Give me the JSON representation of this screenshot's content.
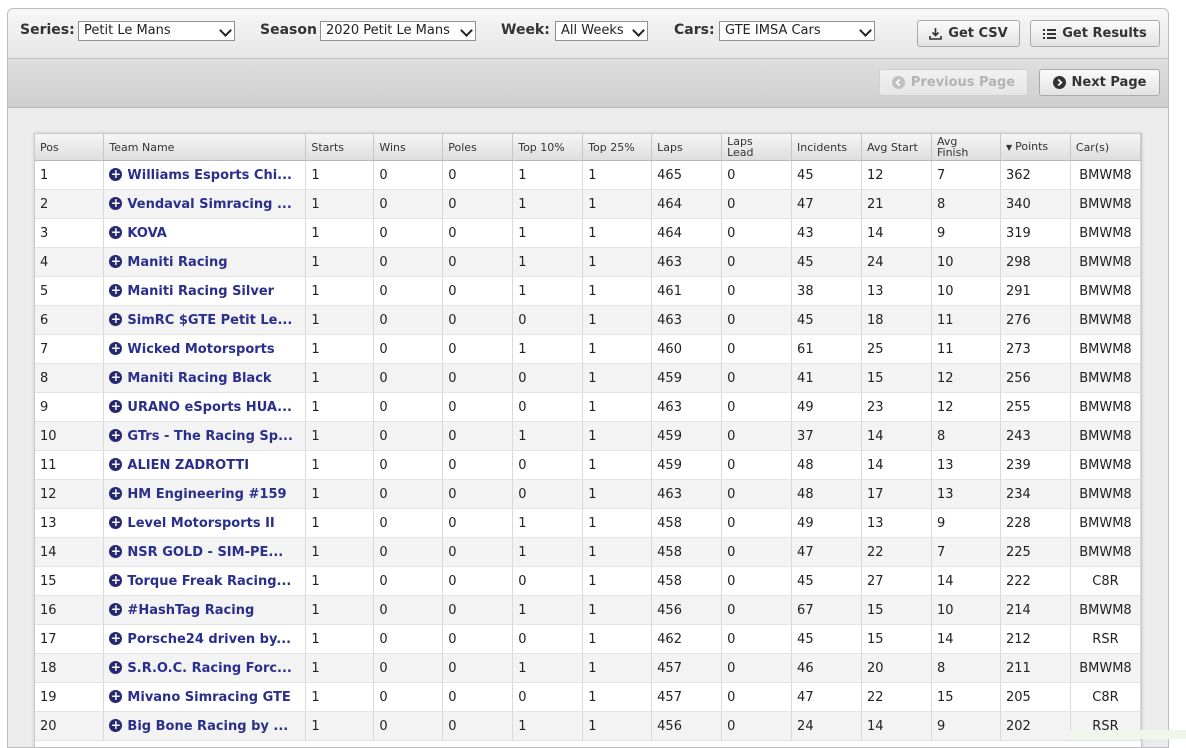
{
  "filters": {
    "series_label": "Series:",
    "series_value": "Petit Le Mans",
    "season_label": "Season",
    "season_value": "2020 Petit Le Mans",
    "week_label": "Week:",
    "week_value": "All Weeks",
    "cars_label": "Cars:",
    "cars_value": "GTE IMSA Cars"
  },
  "buttons": {
    "csv": "Get CSV",
    "results": "Get Results",
    "prev": "Previous Page",
    "next": "Next Page"
  },
  "table": {
    "columns": [
      "Pos",
      "Team Name",
      "Starts",
      "Wins",
      "Poles",
      "Top 10%",
      "Top 25%",
      "Laps",
      "Laps Lead",
      "Incidents",
      "Avg Start",
      "Avg Finish",
      "Points",
      "Car(s)"
    ],
    "sorted_column": "Points",
    "rows": [
      {
        "pos": "1",
        "team": "Williams Esports Chi...",
        "starts": "1",
        "wins": "0",
        "poles": "0",
        "top10": "1",
        "top25": "1",
        "laps": "465",
        "lead": "0",
        "inc": "45",
        "avgstart": "12",
        "avgfinish": "7",
        "points": "362",
        "car": "BMWM8"
      },
      {
        "pos": "2",
        "team": "Vendaval Simracing ...",
        "starts": "1",
        "wins": "0",
        "poles": "0",
        "top10": "1",
        "top25": "1",
        "laps": "464",
        "lead": "0",
        "inc": "47",
        "avgstart": "21",
        "avgfinish": "8",
        "points": "340",
        "car": "BMWM8"
      },
      {
        "pos": "3",
        "team": "KOVA",
        "starts": "1",
        "wins": "0",
        "poles": "0",
        "top10": "1",
        "top25": "1",
        "laps": "464",
        "lead": "0",
        "inc": "43",
        "avgstart": "14",
        "avgfinish": "9",
        "points": "319",
        "car": "BMWM8"
      },
      {
        "pos": "4",
        "team": "Maniti Racing",
        "starts": "1",
        "wins": "0",
        "poles": "0",
        "top10": "1",
        "top25": "1",
        "laps": "463",
        "lead": "0",
        "inc": "45",
        "avgstart": "24",
        "avgfinish": "10",
        "points": "298",
        "car": "BMWM8"
      },
      {
        "pos": "5",
        "team": "Maniti Racing Silver",
        "starts": "1",
        "wins": "0",
        "poles": "0",
        "top10": "1",
        "top25": "1",
        "laps": "461",
        "lead": "0",
        "inc": "38",
        "avgstart": "13",
        "avgfinish": "10",
        "points": "291",
        "car": "BMWM8"
      },
      {
        "pos": "6",
        "team": "SimRC $GTE Petit Le...",
        "starts": "1",
        "wins": "0",
        "poles": "0",
        "top10": "0",
        "top25": "1",
        "laps": "463",
        "lead": "0",
        "inc": "45",
        "avgstart": "18",
        "avgfinish": "11",
        "points": "276",
        "car": "BMWM8"
      },
      {
        "pos": "7",
        "team": "Wicked Motorsports",
        "starts": "1",
        "wins": "0",
        "poles": "0",
        "top10": "1",
        "top25": "1",
        "laps": "460",
        "lead": "0",
        "inc": "61",
        "avgstart": "25",
        "avgfinish": "11",
        "points": "273",
        "car": "BMWM8"
      },
      {
        "pos": "8",
        "team": "Maniti Racing Black",
        "starts": "1",
        "wins": "0",
        "poles": "0",
        "top10": "0",
        "top25": "1",
        "laps": "459",
        "lead": "0",
        "inc": "41",
        "avgstart": "15",
        "avgfinish": "12",
        "points": "256",
        "car": "BMWM8"
      },
      {
        "pos": "9",
        "team": "URANO eSports HUA...",
        "starts": "1",
        "wins": "0",
        "poles": "0",
        "top10": "0",
        "top25": "1",
        "laps": "463",
        "lead": "0",
        "inc": "49",
        "avgstart": "23",
        "avgfinish": "12",
        "points": "255",
        "car": "BMWM8"
      },
      {
        "pos": "10",
        "team": "GTrs - The Racing Sp...",
        "starts": "1",
        "wins": "0",
        "poles": "0",
        "top10": "1",
        "top25": "1",
        "laps": "459",
        "lead": "0",
        "inc": "37",
        "avgstart": "14",
        "avgfinish": "8",
        "points": "243",
        "car": "BMWM8"
      },
      {
        "pos": "11",
        "team": "ALIEN ZADROTTI",
        "starts": "1",
        "wins": "0",
        "poles": "0",
        "top10": "0",
        "top25": "1",
        "laps": "459",
        "lead": "0",
        "inc": "48",
        "avgstart": "14",
        "avgfinish": "13",
        "points": "239",
        "car": "BMWM8"
      },
      {
        "pos": "12",
        "team": "HM Engineering #159",
        "starts": "1",
        "wins": "0",
        "poles": "0",
        "top10": "0",
        "top25": "1",
        "laps": "463",
        "lead": "0",
        "inc": "48",
        "avgstart": "17",
        "avgfinish": "13",
        "points": "234",
        "car": "BMWM8"
      },
      {
        "pos": "13",
        "team": "Level Motorsports II",
        "starts": "1",
        "wins": "0",
        "poles": "0",
        "top10": "1",
        "top25": "1",
        "laps": "458",
        "lead": "0",
        "inc": "49",
        "avgstart": "13",
        "avgfinish": "9",
        "points": "228",
        "car": "BMWM8"
      },
      {
        "pos": "14",
        "team": "NSR GOLD - SIM-PE...",
        "starts": "1",
        "wins": "0",
        "poles": "0",
        "top10": "1",
        "top25": "1",
        "laps": "458",
        "lead": "0",
        "inc": "47",
        "avgstart": "22",
        "avgfinish": "7",
        "points": "225",
        "car": "BMWM8"
      },
      {
        "pos": "15",
        "team": "Torque Freak Racing...",
        "starts": "1",
        "wins": "0",
        "poles": "0",
        "top10": "0",
        "top25": "1",
        "laps": "458",
        "lead": "0",
        "inc": "45",
        "avgstart": "27",
        "avgfinish": "14",
        "points": "222",
        "car": "C8R"
      },
      {
        "pos": "16",
        "team": "#HashTag Racing",
        "starts": "1",
        "wins": "0",
        "poles": "0",
        "top10": "1",
        "top25": "1",
        "laps": "456",
        "lead": "0",
        "inc": "67",
        "avgstart": "15",
        "avgfinish": "10",
        "points": "214",
        "car": "BMWM8"
      },
      {
        "pos": "17",
        "team": "Porsche24 driven by...",
        "starts": "1",
        "wins": "0",
        "poles": "0",
        "top10": "0",
        "top25": "1",
        "laps": "462",
        "lead": "0",
        "inc": "45",
        "avgstart": "15",
        "avgfinish": "14",
        "points": "212",
        "car": "RSR"
      },
      {
        "pos": "18",
        "team": "S.R.O.C. Racing Forc...",
        "starts": "1",
        "wins": "0",
        "poles": "0",
        "top10": "1",
        "top25": "1",
        "laps": "457",
        "lead": "0",
        "inc": "46",
        "avgstart": "20",
        "avgfinish": "8",
        "points": "211",
        "car": "BMWM8"
      },
      {
        "pos": "19",
        "team": "Mivano Simracing GTE",
        "starts": "1",
        "wins": "0",
        "poles": "0",
        "top10": "0",
        "top25": "1",
        "laps": "457",
        "lead": "0",
        "inc": "47",
        "avgstart": "22",
        "avgfinish": "15",
        "points": "205",
        "car": "C8R"
      },
      {
        "pos": "20",
        "team": "Big Bone Racing by ...",
        "starts": "1",
        "wins": "0",
        "poles": "0",
        "top10": "1",
        "top25": "1",
        "laps": "456",
        "lead": "0",
        "inc": "24",
        "avgstart": "14",
        "avgfinish": "9",
        "points": "202",
        "car": "RSR"
      }
    ]
  }
}
